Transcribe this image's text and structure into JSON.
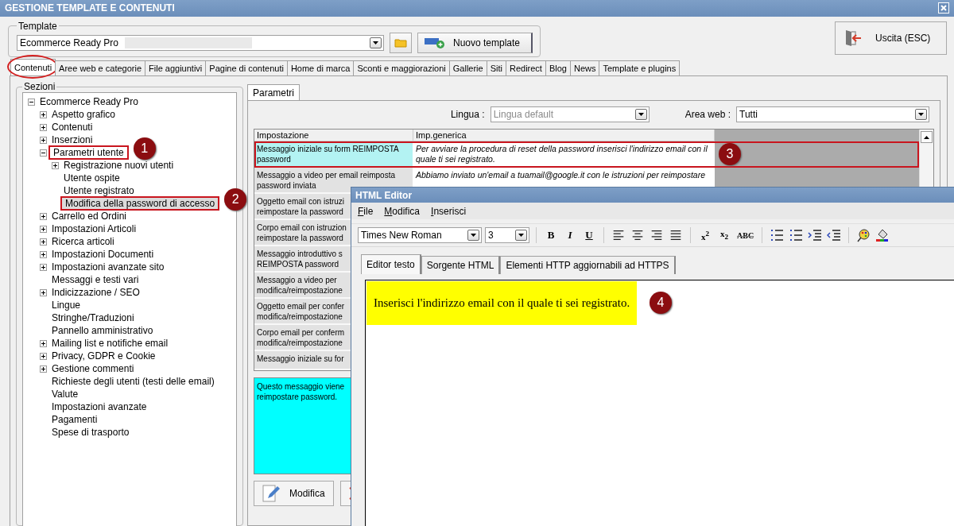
{
  "window": {
    "title": "GESTIONE TEMPLATE E CONTENUTI"
  },
  "template": {
    "legend": "Template",
    "value": "Ecommerce Ready Pro",
    "new_button": "Nuovo template"
  },
  "exit_button": "Uscita (ESC)",
  "tabs": [
    {
      "label": "Contenuti",
      "selected": true,
      "highlighted": true
    },
    {
      "label": "Aree web e categorie",
      "selected": false,
      "highlighted": false
    },
    {
      "label": "File aggiuntivi",
      "selected": false,
      "highlighted": false
    },
    {
      "label": "Pagine di contenuti",
      "selected": false,
      "highlighted": false
    },
    {
      "label": "Home di marca",
      "selected": false,
      "highlighted": false
    },
    {
      "label": "Sconti e maggiorazioni",
      "selected": false,
      "highlighted": false
    },
    {
      "label": "Gallerie",
      "selected": false,
      "highlighted": false
    },
    {
      "label": "Siti",
      "selected": false,
      "highlighted": false
    },
    {
      "label": "Redirect",
      "selected": false,
      "highlighted": false
    },
    {
      "label": "Blog",
      "selected": false,
      "highlighted": false
    },
    {
      "label": "News",
      "selected": false,
      "highlighted": false
    },
    {
      "label": "Template e plugins",
      "selected": false,
      "highlighted": false
    }
  ],
  "sections": {
    "legend": "Sezioni",
    "tree": [
      {
        "label": "Ecommerce Ready Pro",
        "kind": "folder",
        "expanded": true,
        "selected": false,
        "highlighted": false,
        "children": [
          {
            "label": "Aspetto grafico",
            "kind": "folder",
            "expanded": false,
            "selected": false,
            "highlighted": false
          },
          {
            "label": "Contenuti",
            "kind": "folder",
            "expanded": false,
            "selected": false,
            "highlighted": false
          },
          {
            "label": "Inserzioni",
            "kind": "folder",
            "expanded": false,
            "selected": false,
            "highlighted": false
          },
          {
            "label": "Parametri utente",
            "kind": "folder",
            "expanded": true,
            "selected": false,
            "highlighted": true,
            "callout": "1",
            "children": [
              {
                "label": "Registrazione nuovi utenti",
                "kind": "folder",
                "expanded": false,
                "selected": false,
                "highlighted": false
              },
              {
                "label": "Utente ospite",
                "kind": "leaf",
                "selected": false,
                "highlighted": false
              },
              {
                "label": "Utente registrato",
                "kind": "leaf",
                "selected": false,
                "highlighted": false
              },
              {
                "label": "Modifica della password di accesso",
                "kind": "leaf",
                "selected": true,
                "highlighted": true,
                "callout": "2"
              }
            ]
          },
          {
            "label": "Carrello ed Ordini",
            "kind": "folder",
            "expanded": false,
            "selected": false,
            "highlighted": false
          },
          {
            "label": "Impostazioni Articoli",
            "kind": "folder",
            "expanded": false,
            "selected": false,
            "highlighted": false
          },
          {
            "label": "Ricerca articoli",
            "kind": "folder",
            "expanded": false,
            "selected": false,
            "highlighted": false
          },
          {
            "label": "Impostazioni Documenti",
            "kind": "folder",
            "expanded": false,
            "selected": false,
            "highlighted": false
          },
          {
            "label": "Impostazioni avanzate sito",
            "kind": "folder",
            "expanded": false,
            "selected": false,
            "highlighted": false
          },
          {
            "label": "Messaggi e testi vari",
            "kind": "leaf",
            "selected": false,
            "highlighted": false
          },
          {
            "label": "Indicizzazione / SEO",
            "kind": "folder",
            "expanded": false,
            "selected": false,
            "highlighted": false
          },
          {
            "label": "Lingue",
            "kind": "leaf",
            "selected": false,
            "highlighted": false
          },
          {
            "label": "Stringhe/Traduzioni",
            "kind": "leaf",
            "selected": false,
            "highlighted": false
          },
          {
            "label": "Pannello amministrativo",
            "kind": "leaf",
            "selected": false,
            "highlighted": false
          },
          {
            "label": "Mailing list e notifiche email",
            "kind": "folder",
            "expanded": false,
            "selected": false,
            "highlighted": false
          },
          {
            "label": "Privacy, GDPR e Cookie",
            "kind": "folder",
            "expanded": false,
            "selected": false,
            "highlighted": false
          },
          {
            "label": "Gestione commenti",
            "kind": "folder",
            "expanded": false,
            "selected": false,
            "highlighted": false
          },
          {
            "label": "Richieste degli utenti (testi delle email)",
            "kind": "leaf",
            "selected": false,
            "highlighted": false
          },
          {
            "label": "Valute",
            "kind": "leaf",
            "selected": false,
            "highlighted": false
          },
          {
            "label": "Impostazioni avanzate",
            "kind": "leaf",
            "selected": false,
            "highlighted": false
          },
          {
            "label": "Pagamenti",
            "kind": "leaf",
            "selected": false,
            "highlighted": false
          },
          {
            "label": "Spese di trasporto",
            "kind": "leaf",
            "selected": false,
            "highlighted": false
          }
        ]
      }
    ]
  },
  "subtabs": [
    {
      "label": "Parametri",
      "selected": true
    }
  ],
  "filters": [
    {
      "label": "Lingua :",
      "value": "Lingua default",
      "disabled": true
    },
    {
      "label": "Area web :",
      "value": "Tutti",
      "disabled": false
    }
  ],
  "table": {
    "columns": [
      "Impostazione",
      "Imp.generica"
    ],
    "rows": [
      {
        "setting": "Messaggio iniziale su form REIMPOSTA password",
        "value": "Per avviare la procedura di reset della password inserisci l'indirizzo email con il quale ti sei registrato.",
        "selected": true,
        "highlighted": true,
        "callout": "3"
      },
      {
        "setting": "Messaggio a video per email reimposta password inviata",
        "value": "Abbiamo inviato un'email a tuamail@google.it con le istruzioni per reimpostare",
        "selected": false,
        "highlighted": false
      },
      {
        "setting": "Oggetto email con istruzi\nreimpostare la password",
        "selected": false,
        "highlighted": false
      },
      {
        "setting": "Corpo email con istruzion\nreimpostare la password",
        "selected": false,
        "highlighted": false
      },
      {
        "setting": "Messaggio introduttivo s\nREIMPOSTA password",
        "selected": false,
        "highlighted": false
      },
      {
        "setting": "Messaggio a video per\nmodifica/reimpostazione",
        "selected": false,
        "highlighted": false
      },
      {
        "setting": "Oggetto email per confer\nmodifica/reimpostazione",
        "selected": false,
        "highlighted": false
      },
      {
        "setting": "Corpo email per conferm\nmodifica/reimpostazione",
        "selected": false,
        "highlighted": false
      },
      {
        "setting": "Messaggio iniziale su for",
        "selected": false,
        "highlighted": false
      }
    ]
  },
  "description": "Questo messaggio viene\nreimpostare password.",
  "buttons": [
    {
      "label": "Modifica",
      "kind": "edit"
    },
    {
      "kind": "delete"
    }
  ],
  "editor": {
    "title": "HTML Editor",
    "menu": [
      "File",
      "Modifica",
      "Inserisci"
    ],
    "font": "Times New Roman",
    "size": "3",
    "style_buttons": [
      {
        "label": "B",
        "kind": "bold"
      },
      {
        "label": "I",
        "kind": "italic"
      },
      {
        "label": "U",
        "kind": "underline"
      }
    ],
    "script_buttons": [
      {
        "label": "x$^{2}$",
        "kind": "superscript"
      },
      {
        "label": "x$_{2}$",
        "kind": "subscript"
      },
      {
        "label": "ABC",
        "kind": "strike"
      }
    ],
    "tabs": [
      {
        "label": "Editor testo",
        "selected": true
      },
      {
        "label": "Sorgente HTML",
        "selected": false
      },
      {
        "label": "Elementi HTTP aggiornabili ad HTTPS",
        "selected": false
      }
    ],
    "content": "Inserisci l'indirizzo email con il quale ti sei registrato.",
    "callout": "4"
  }
}
